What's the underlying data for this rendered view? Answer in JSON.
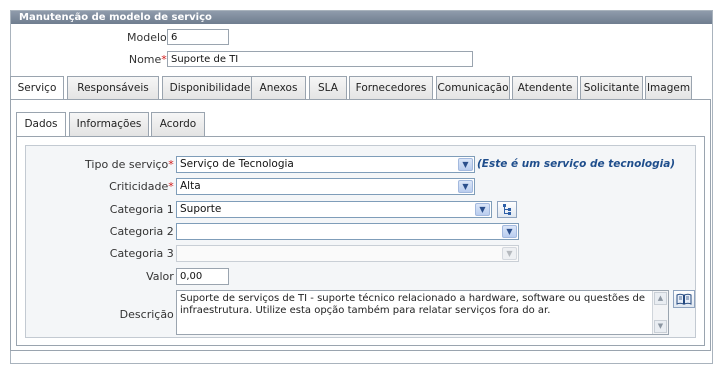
{
  "panel": {
    "title": "Manutenção de modelo de serviço"
  },
  "header": {
    "modelo_label": "Modelo :",
    "modelo_value": "6",
    "nome_label": "Nome",
    "nome_required": "*",
    "nome_colon": " :",
    "nome_value": "Suporte de TI"
  },
  "tabs": [
    {
      "label": "Serviço",
      "active": true
    },
    {
      "label": "Responsáveis"
    },
    {
      "label": "Disponibilidade"
    },
    {
      "label": "Anexos"
    },
    {
      "label": "SLA"
    },
    {
      "label": "Fornecedores"
    },
    {
      "label": "Comunicação"
    },
    {
      "label": "Atendente"
    },
    {
      "label": "Solicitante"
    },
    {
      "label": "Imagem"
    }
  ],
  "subtabs": [
    {
      "label": "Dados",
      "active": true
    },
    {
      "label": "Informações"
    },
    {
      "label": "Acordo"
    }
  ],
  "form": {
    "tipo_label": "Tipo de serviço",
    "tipo_value": "Serviço de Tecnologia",
    "tipo_note": "(Este é um serviço de tecnologia)",
    "criticidade_label": "Criticidade",
    "criticidade_value": "Alta",
    "cat1_label": "Categoria 1 :",
    "cat1_value": "Suporte",
    "cat2_label": "Categoria 2 :",
    "cat2_value": "",
    "cat3_label": "Categoria 3 :",
    "cat3_value": "",
    "valor_label": "Valor :",
    "valor_value": "0,00",
    "descricao_label": "Descrição :",
    "descricao_value": "Suporte de serviços de TI - suporte técnico relacionado a hardware, software ou questões de infraestrutura. Utilize esta opção também para relatar serviços fora do ar.",
    "required_mark": "*",
    "colon": " :"
  },
  "icons": {
    "dropdown": "chevron-down-icon",
    "tree": "tree-icon",
    "book": "book-icon"
  },
  "colors": {
    "title_bar": "#7b8899",
    "required": "#d01818",
    "note": "#1f4e8c"
  }
}
